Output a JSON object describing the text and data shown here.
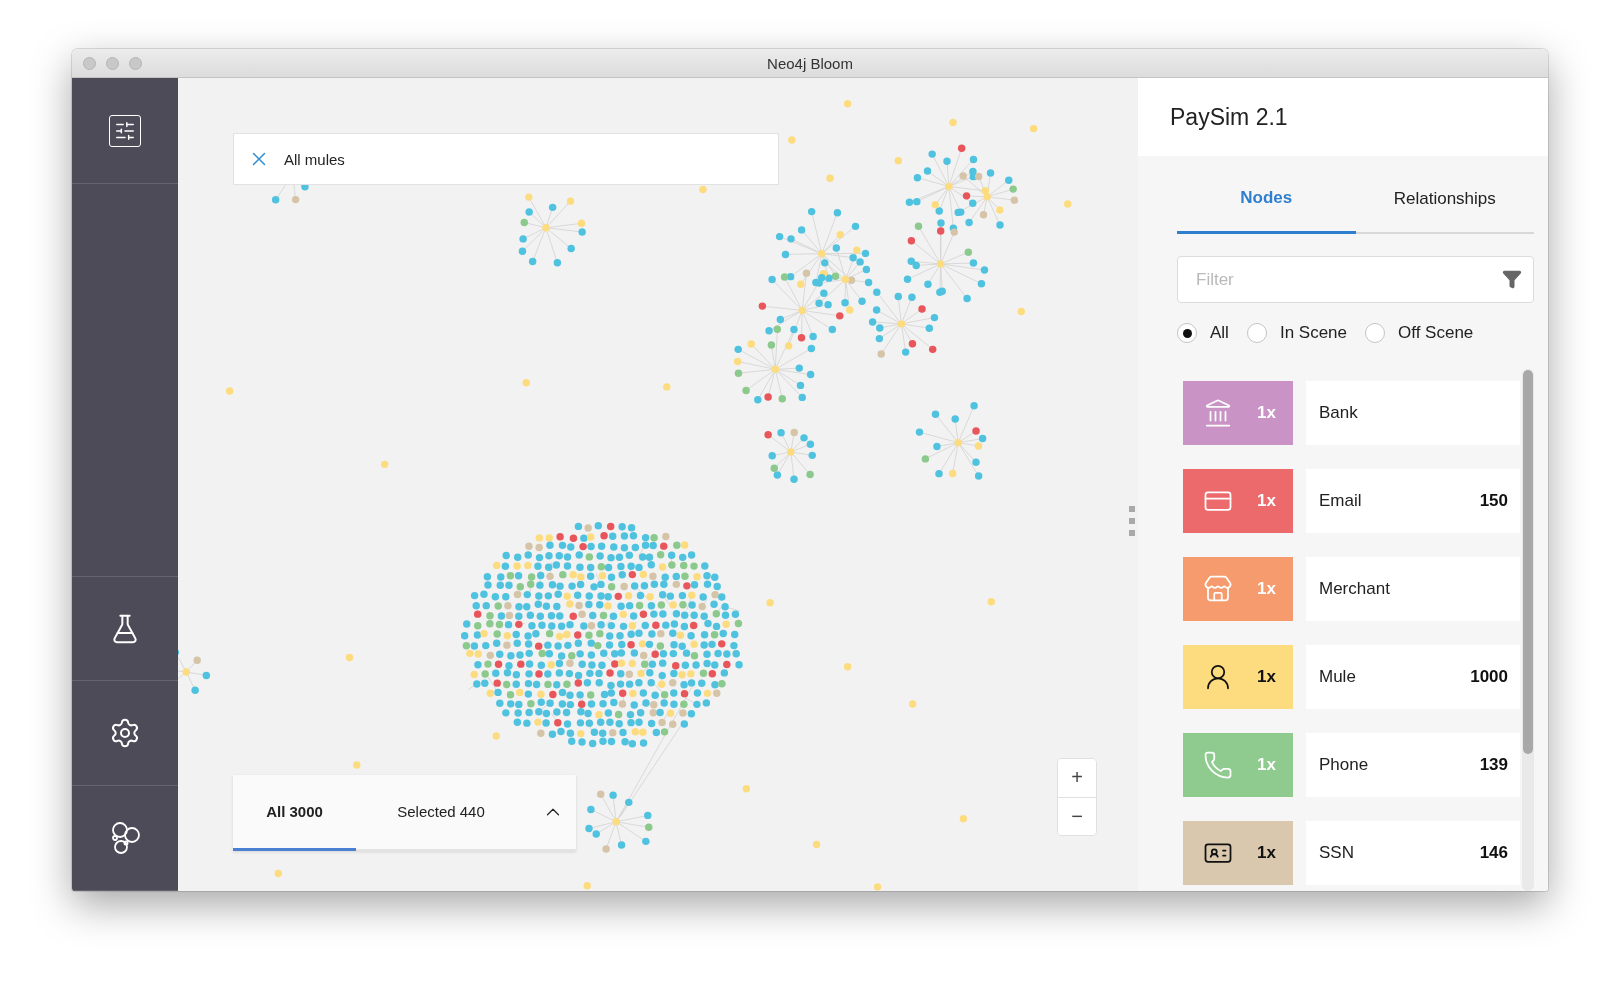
{
  "window": {
    "title": "Neo4j Bloom"
  },
  "search": {
    "value": "All mules"
  },
  "selection_tabs": [
    {
      "label": "All 3000",
      "selected": true
    },
    {
      "label": "Selected 440",
      "selected": false
    }
  ],
  "zoom_controls": [
    "+",
    "−"
  ],
  "panel": {
    "title": "PaySim 2.1",
    "tabs": [
      {
        "label": "Nodes",
        "selected": true
      },
      {
        "label": "Relationships",
        "selected": false
      }
    ],
    "filter": {
      "placeholder": "Filter"
    },
    "scope": [
      {
        "label": "All",
        "selected": true
      },
      {
        "label": "In Scene",
        "selected": false
      },
      {
        "label": "Off Scene",
        "selected": false
      }
    ],
    "categories": [
      {
        "multiplier": "1x",
        "label": "Bank",
        "color": "#c993c6"
      },
      {
        "multiplier": "1x",
        "label": "Email",
        "count": "150",
        "color": "#ec6a6c"
      },
      {
        "multiplier": "1x",
        "label": "Merchant",
        "color": "#f59b6d"
      },
      {
        "multiplier": "1x",
        "label": "Mule",
        "count": "1000",
        "color": "#fddc7f"
      },
      {
        "multiplier": "1x",
        "label": "Phone",
        "count": "139",
        "color": "#8fcb8f"
      },
      {
        "multiplier": "1x",
        "label": "SSN",
        "count": "146",
        "color": "#d9c8ae"
      }
    ]
  }
}
